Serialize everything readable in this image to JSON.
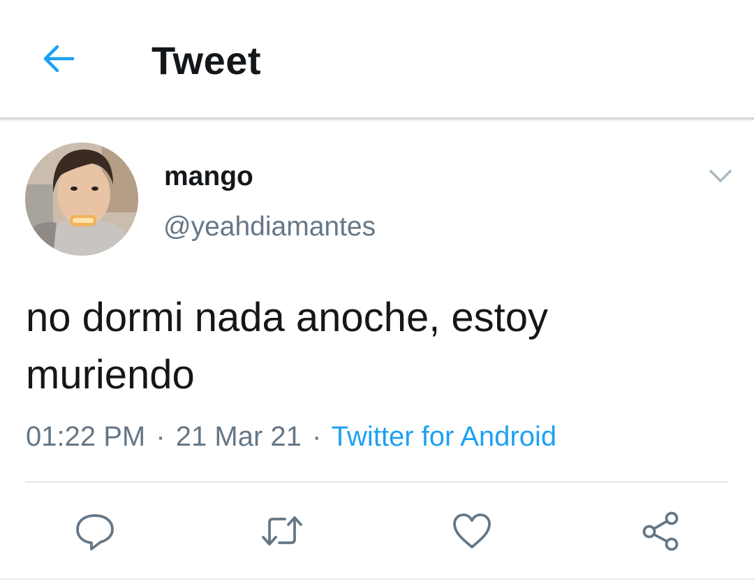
{
  "header": {
    "title": "Tweet",
    "back_icon": "arrow-left-icon"
  },
  "tweet": {
    "author": {
      "display_name": "mango",
      "handle": "@yeahdiamantes",
      "avatar": "user-avatar-photo"
    },
    "text": "no dormi nada anoche, estoy muriendo",
    "time": "01:22 PM",
    "separator": "·",
    "date": "21 Mar 21",
    "source": "Twitter for Android"
  },
  "actions": {
    "reply_icon": "reply-icon",
    "retweet_icon": "retweet-icon",
    "like_icon": "heart-icon",
    "share_icon": "share-icon"
  },
  "colors": {
    "accent": "#1da1f2",
    "text_primary": "#14171a",
    "text_secondary": "#657786",
    "icon_gray": "#657786",
    "divider": "#e1e8ed"
  }
}
